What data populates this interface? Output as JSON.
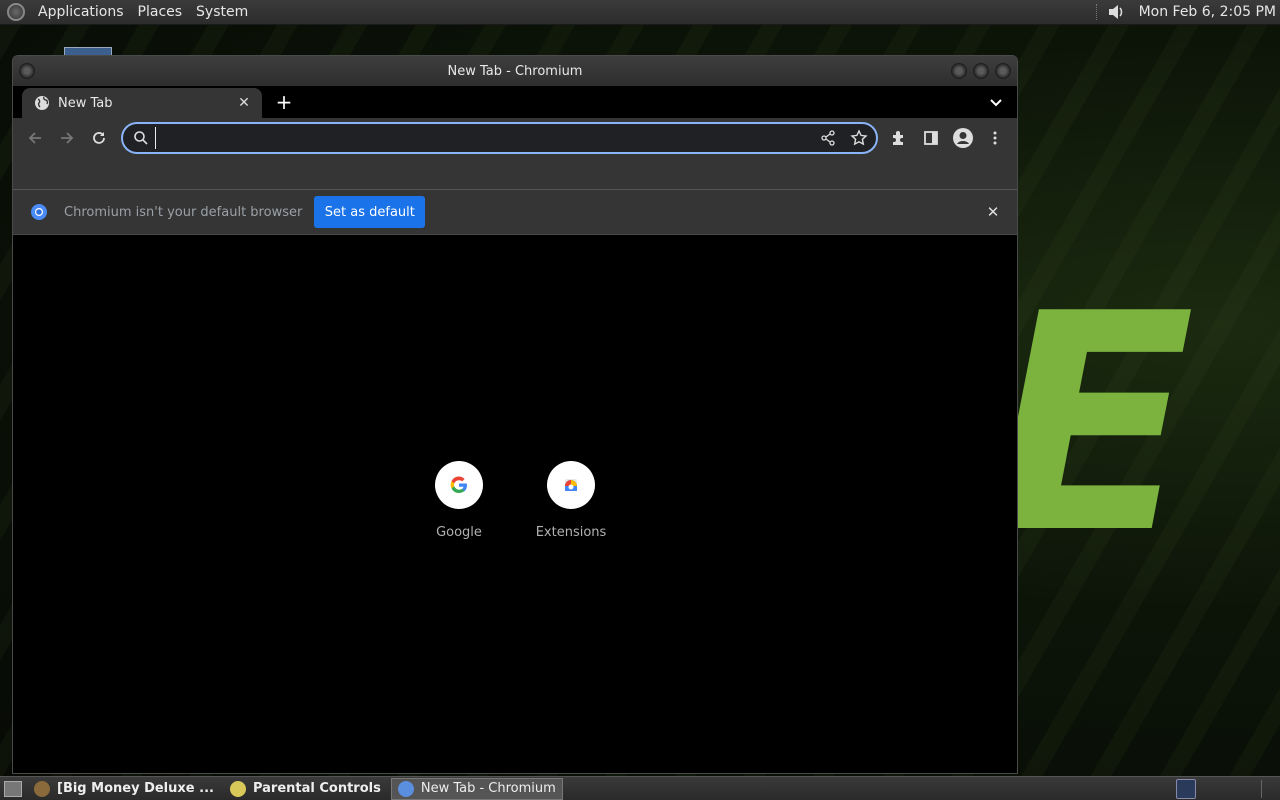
{
  "top_panel": {
    "menus": [
      "Applications",
      "Places",
      "System"
    ],
    "clock": "Mon Feb  6,  2:05 PM"
  },
  "window": {
    "title": "New Tab - Chromium"
  },
  "tab": {
    "label": "New Tab"
  },
  "omnibox": {
    "value": ""
  },
  "infobar": {
    "message": "Chromium isn't your default browser",
    "button_label": "Set as default"
  },
  "shortcuts": [
    {
      "label": "Google"
    },
    {
      "label": "Extensions"
    }
  ],
  "taskbar": {
    "tasks": [
      {
        "label": "[Big Money Deluxe ..."
      },
      {
        "label": "Parental Controls"
      },
      {
        "label": "New Tab - Chromium"
      }
    ]
  },
  "colors": {
    "accent": "#1a73e8",
    "omnibox_focus": "#8ab4f8",
    "desktop_letter": "#7bb33e"
  },
  "desktop": {
    "background_letter": "E"
  }
}
